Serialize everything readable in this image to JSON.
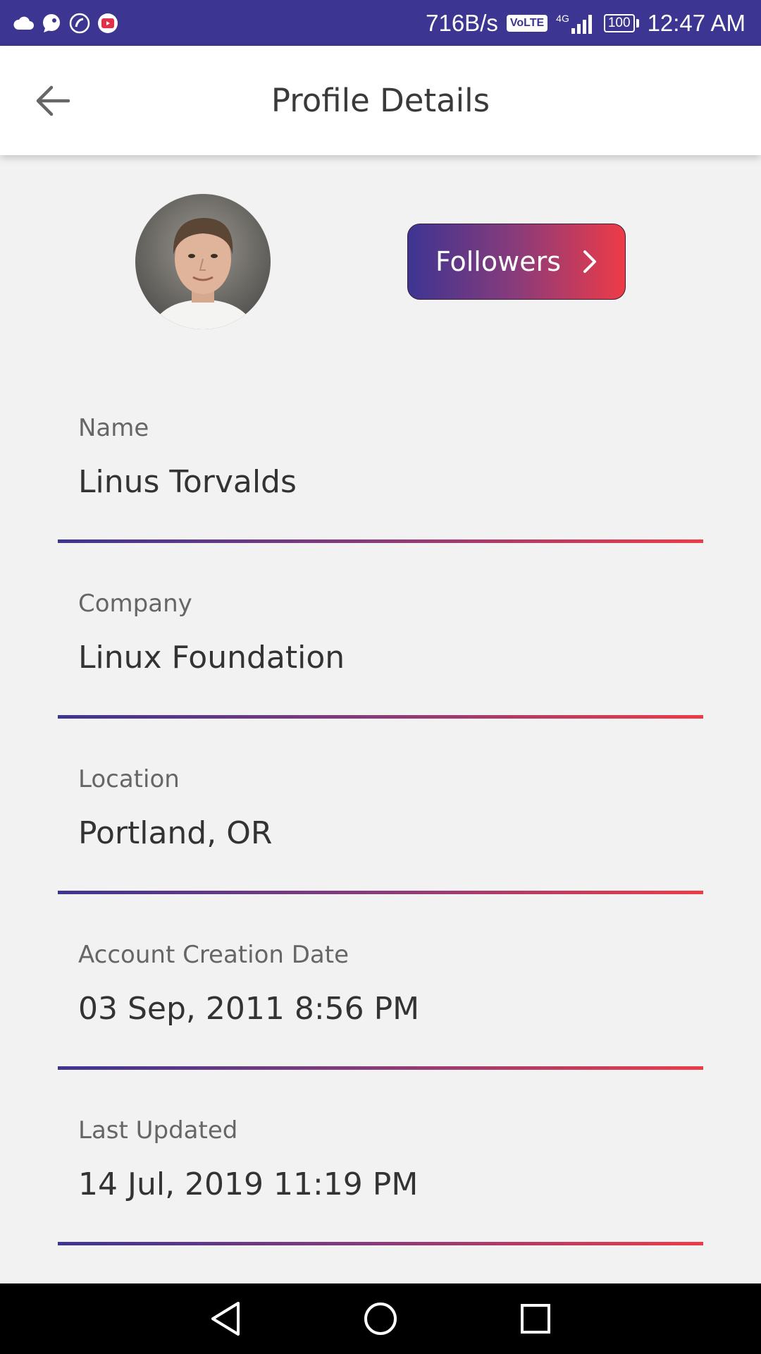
{
  "status_bar": {
    "net_speed": "716B/s",
    "volte": "VoLTE",
    "network": "4G",
    "battery": "100",
    "time": "12:47 AM",
    "icons": [
      "cloud-icon",
      "chat-bubble-icon",
      "phone-app-icon",
      "youtube-icon"
    ]
  },
  "app_bar": {
    "title": "Profile Details",
    "back_icon": "arrow-back-icon"
  },
  "profile": {
    "avatar": "user-avatar-photo",
    "followers_label": "Followers",
    "followers_icon": "chevron-right-icon"
  },
  "fields": [
    {
      "label": "Name",
      "value": "Linus Torvalds"
    },
    {
      "label": "Company",
      "value": "Linux Foundation"
    },
    {
      "label": "Location",
      "value": "Portland, OR"
    },
    {
      "label": "Account Creation Date",
      "value": "03 Sep, 2011 8:56 PM"
    },
    {
      "label": "Last Updated",
      "value": "14 Jul, 2019 11:19 PM"
    }
  ],
  "nav_bar": {
    "back": "nav-back-icon",
    "home": "nav-home-icon",
    "recents": "nav-recents-icon"
  },
  "colors": {
    "primary": "#3d3592",
    "accent": "#ee3b47",
    "background": "#f2f2f2"
  }
}
